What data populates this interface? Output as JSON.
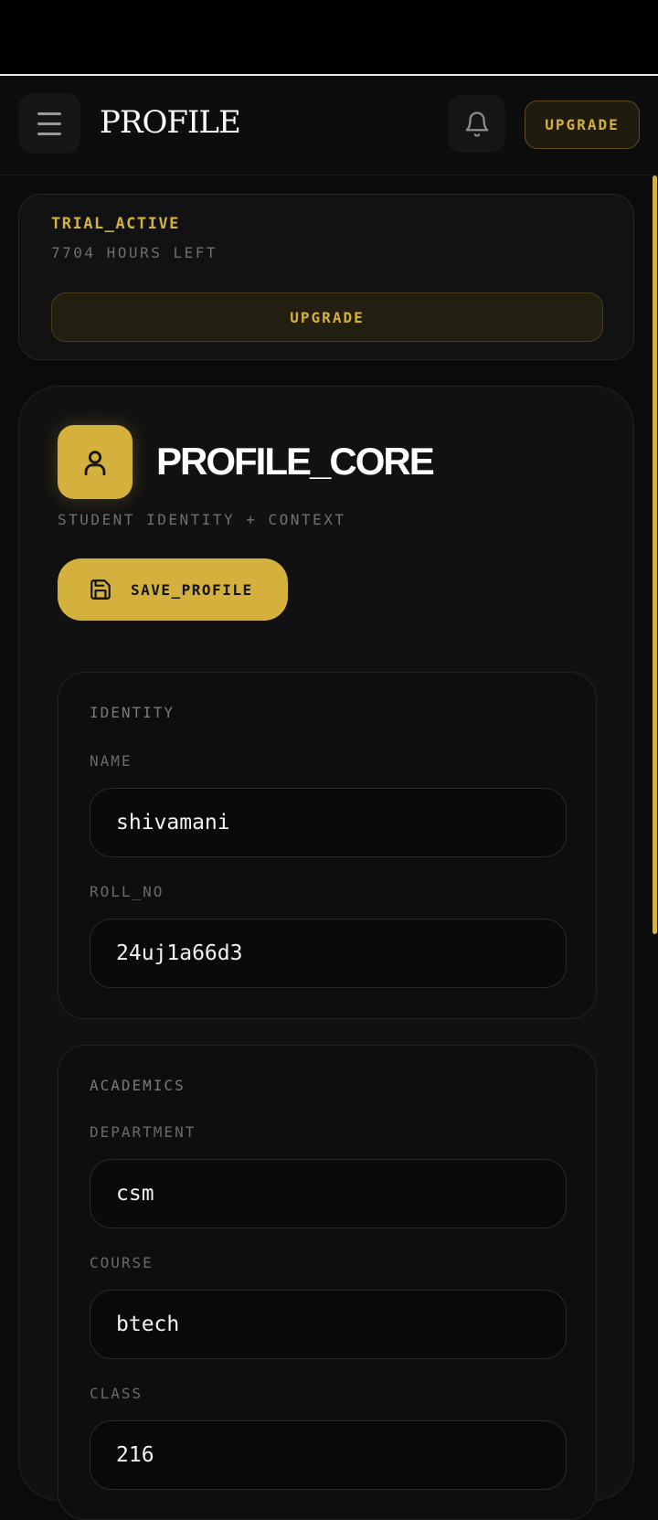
{
  "header": {
    "title": "PROFILE",
    "upgrade_label": "UPGRADE"
  },
  "trial": {
    "status": "TRIAL_ACTIVE",
    "hours_left": "7704 HOURS LEFT",
    "upgrade_label": "UPGRADE"
  },
  "profile": {
    "title": "PROFILE_CORE",
    "subtitle": "STUDENT IDENTITY + CONTEXT",
    "save_label": "SAVE_PROFILE"
  },
  "identity": {
    "title": "IDENTITY",
    "name_label": "NAME",
    "name_value": "shivamani",
    "roll_label": "ROLL_NO",
    "roll_value": "24uj1a66d3"
  },
  "academics": {
    "title": "ACADEMICS",
    "department_label": "DEPARTMENT",
    "department_value": "csm",
    "course_label": "COURSE",
    "course_value": "btech",
    "class_label": "CLASS",
    "class_value": "216"
  },
  "icons": {
    "menu": "menu-icon",
    "bell": "bell-icon",
    "user": "user-icon",
    "save": "save-icon"
  },
  "colors": {
    "accent": "#d4b03d",
    "background": "#0b0b0b"
  }
}
